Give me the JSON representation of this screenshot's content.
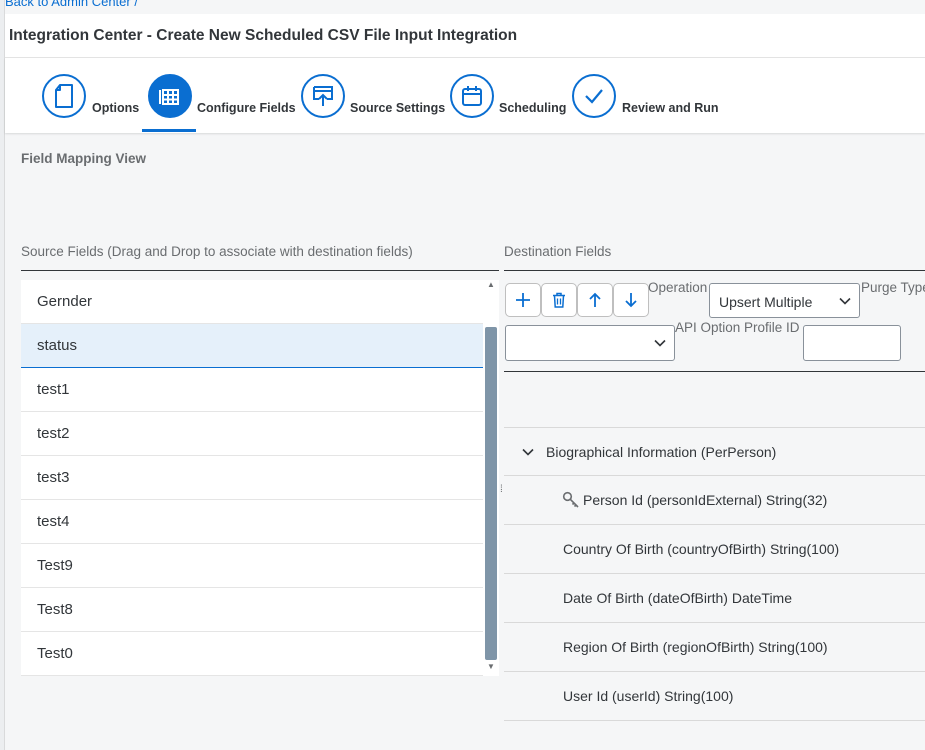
{
  "background": {
    "back_link": "Back to Admin Center /"
  },
  "header": {
    "title": "Integration Center - Create New Scheduled CSV File Input Integration"
  },
  "wizard": {
    "steps": [
      {
        "label": "Options",
        "icon": "document-icon"
      },
      {
        "label": "Configure Fields",
        "icon": "table-icon"
      },
      {
        "label": "Source Settings",
        "icon": "upload-icon"
      },
      {
        "label": "Scheduling",
        "icon": "calendar-icon"
      },
      {
        "label": "Review and Run",
        "icon": "checkmark-icon"
      }
    ],
    "active_step": 1
  },
  "section_title": "Field Mapping View",
  "source": {
    "header": "Source Fields (Drag and Drop to associate with destination fields)",
    "items": [
      "Gernder",
      "status",
      "test1",
      "test2",
      "test3",
      "test4",
      "Test9",
      "Test8",
      "Test0"
    ],
    "selected_index": 1
  },
  "destination": {
    "header": "Destination Fields",
    "toolbar": {
      "add_icon": "add-icon",
      "delete_icon": "trash-icon",
      "move_up_icon": "arrow-up-icon",
      "move_down_icon": "arrow-down-icon"
    },
    "operation_label": "Operation",
    "operation_value": "Upsert Multiple",
    "purge_type_label": "Purge Type",
    "purge_type_value": "",
    "api_option_label": "API Option Profile ID",
    "api_option_value": "",
    "tree": {
      "group": "Biographical Information (PerPerson)",
      "fields": [
        "Person Id (personIdExternal) String(32)",
        "Country Of Birth (countryOfBirth) String(100)",
        "Date Of Birth (dateOfBirth) DateTime",
        "Region Of Birth (regionOfBirth) String(100)",
        "User Id (userId) String(100)"
      ],
      "key_field_index": 0
    }
  },
  "colors": {
    "accent": "#0a6ed1",
    "selected_row": "#e5f0fa",
    "scrollbar": "#7f95a8"
  }
}
